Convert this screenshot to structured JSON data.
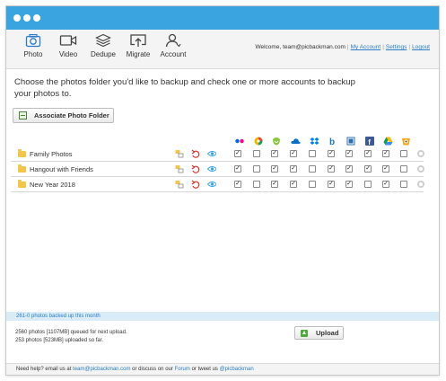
{
  "toolbar": {
    "items": [
      {
        "label": "Photo",
        "icon": "camera-icon"
      },
      {
        "label": "Video",
        "icon": "video-icon"
      },
      {
        "label": "Dedupe",
        "icon": "layers-icon"
      },
      {
        "label": "Migrate",
        "icon": "migrate-icon"
      },
      {
        "label": "Account",
        "icon": "user-icon"
      }
    ]
  },
  "header": {
    "welcome": "Welcome, team@picbackman.com",
    "my_account": "My Account",
    "settings": "Settings",
    "logout": "Logout"
  },
  "intro": "Choose the photos folder you'd like to backup and check one or more accounts to backup your photos to.",
  "associate_button": "Associate Photo Folder",
  "services": [
    "flickr",
    "picasa",
    "smugmug",
    "skydrive",
    "dropbox",
    "box",
    "zenfolio",
    "facebook",
    "google-drive",
    "photobucket"
  ],
  "folders": [
    {
      "name": "Family Photos",
      "checks": [
        true,
        false,
        true,
        true,
        false,
        true,
        true,
        true,
        true,
        false
      ]
    },
    {
      "name": "Hangout with Friends",
      "checks": [
        true,
        false,
        true,
        true,
        false,
        true,
        true,
        true,
        true,
        false
      ]
    },
    {
      "name": "New Year 2018",
      "checks": [
        true,
        false,
        true,
        true,
        false,
        true,
        true,
        false,
        true,
        false
      ]
    }
  ],
  "status": {
    "backed_up": "261-0 photos backed up this month",
    "queued": "2560 photos [1107MB] queued for next upload.",
    "uploaded": "253 photos [523MB] uploaded so far.",
    "upload_button": "Upload"
  },
  "footer": {
    "prefix": "Need help? email us at",
    "email": "team@picbackman.com",
    "middle": "or discuss on our",
    "forum": "Forum",
    "middle2": "or tweet us",
    "twitter": "@picbackman"
  },
  "colors": {
    "accent": "#3aa4e0",
    "link": "#2a7cc7"
  }
}
